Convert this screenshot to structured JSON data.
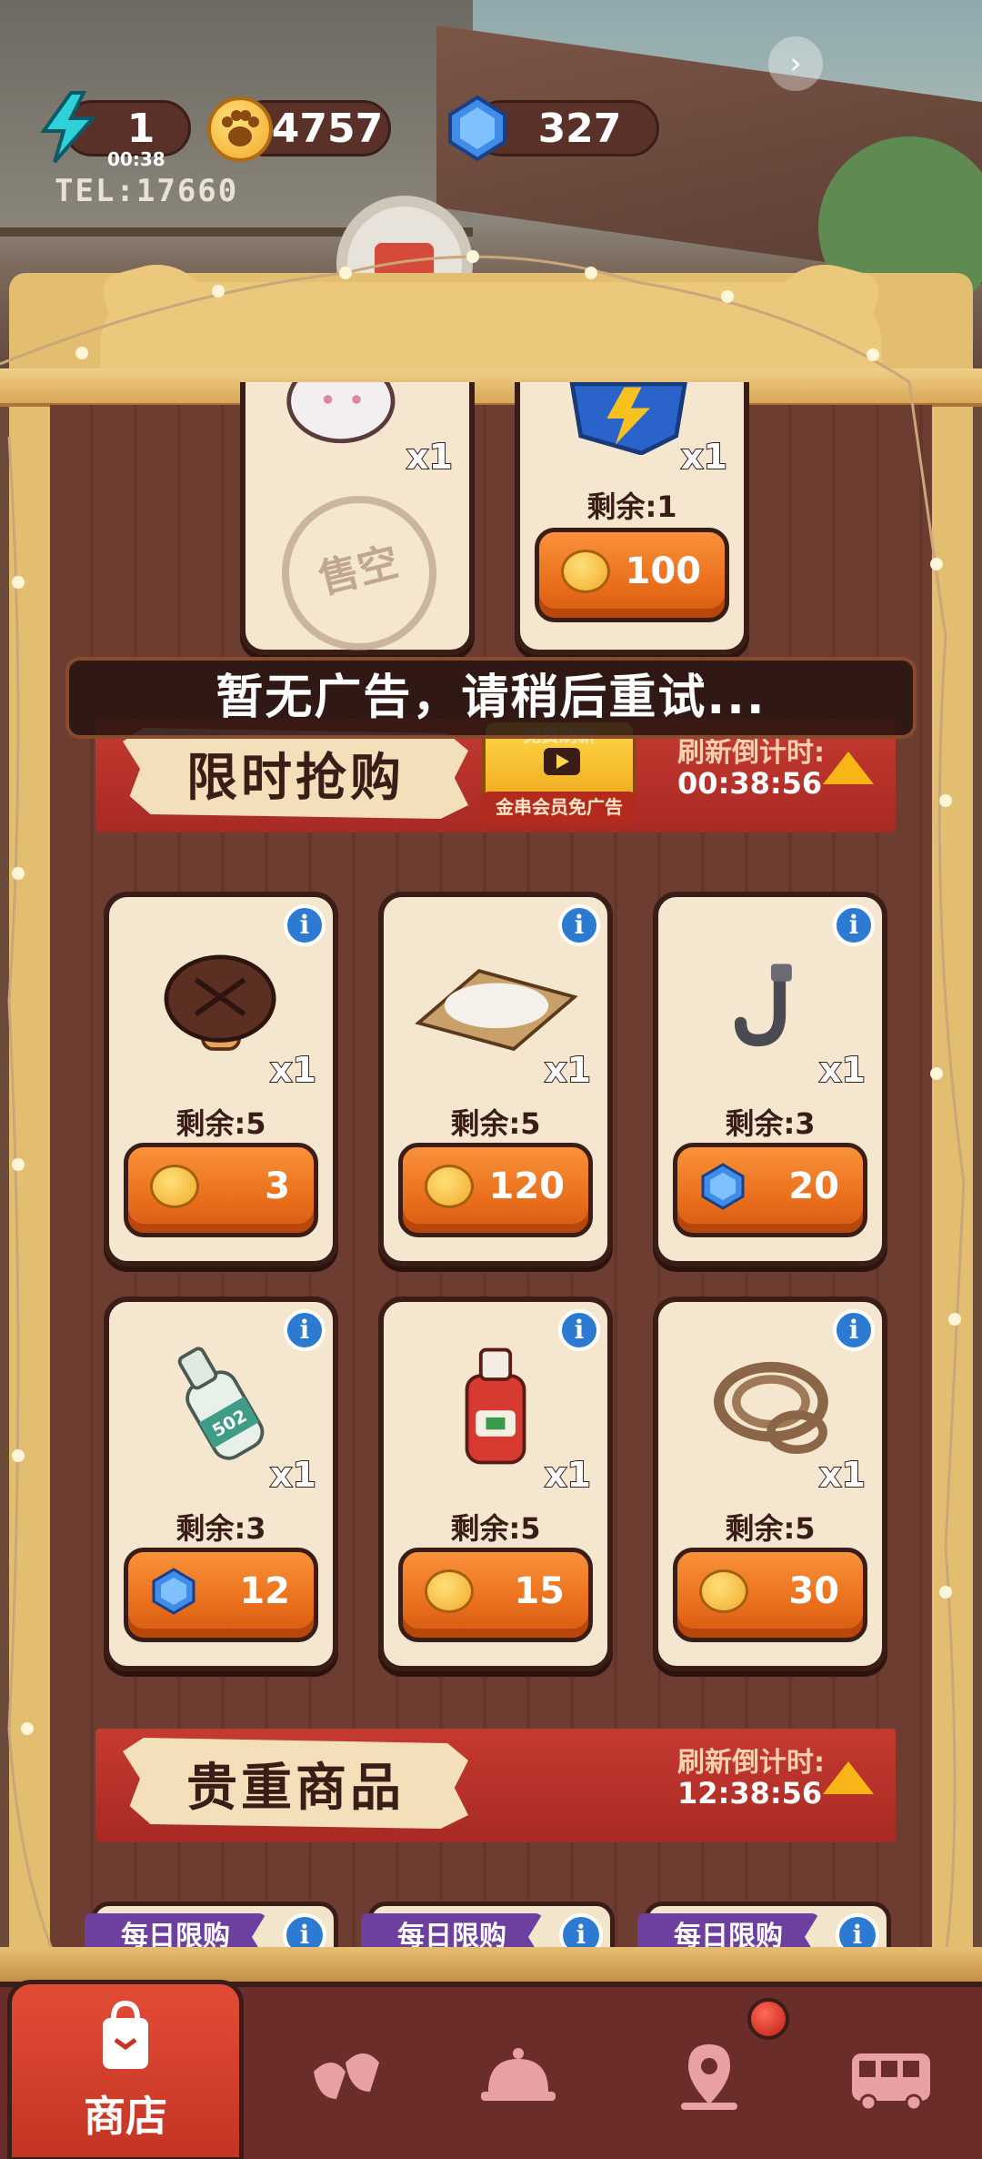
{
  "resources": {
    "energy_value": "1",
    "energy_timer": "00:38",
    "paw_coins": "4757",
    "gems": "327",
    "energy_color": "#2fd1d8",
    "coin_color": "#f2a92a",
    "gem_color": "#3f8de8"
  },
  "background": {
    "sign_text": "TEL:17660"
  },
  "top_row": [
    {
      "qty": "x1",
      "sold_out_stamp": "售空",
      "item": "white-creature-icon"
    },
    {
      "qty": "x1",
      "remaining": "剩余:1",
      "price": "100",
      "currency": "paw-coin",
      "item": "blue-lightning-box-icon"
    }
  ],
  "toast": "暂无广告，请稍后重试...",
  "flash_sale": {
    "title": "限时抢购",
    "ad_button_title": "免费刷新",
    "ad_button_sub": "金串会员免广告",
    "refresh_label": "刷新倒计时:",
    "refresh_time": "00:38:56"
  },
  "flash_items": [
    {
      "name": "mushroom-icon",
      "qty": "x1",
      "remaining": "剩余:5",
      "price": "3",
      "currency": "paw-coin"
    },
    {
      "name": "flour-tray-icon",
      "qty": "x1",
      "remaining": "剩余:5",
      "price": "120",
      "currency": "paw-coin"
    },
    {
      "name": "hook-icon",
      "qty": "x1",
      "remaining": "剩余:3",
      "price": "20",
      "currency": "gem"
    },
    {
      "name": "glue-bottle-icon",
      "qty": "x1",
      "remaining": "剩余:3",
      "price": "12",
      "currency": "gem",
      "bottle_label": "502"
    },
    {
      "name": "ketchup-bottle-icon",
      "qty": "x1",
      "remaining": "剩余:5",
      "price": "15",
      "currency": "paw-coin"
    },
    {
      "name": "rope-coil-icon",
      "qty": "x1",
      "remaining": "剩余:5",
      "price": "30",
      "currency": "paw-coin"
    }
  ],
  "premium": {
    "title": "贵重商品",
    "refresh_label": "刷新倒计时:",
    "refresh_time": "12:38:56"
  },
  "daily_tags": [
    "每日限购",
    "每日限购",
    "每日限购"
  ],
  "nav": {
    "shop_label": "商店",
    "tabs": [
      "shop-bag-icon",
      "cards-icon",
      "cloche-icon",
      "map-pin-icon",
      "bus-icon"
    ]
  }
}
